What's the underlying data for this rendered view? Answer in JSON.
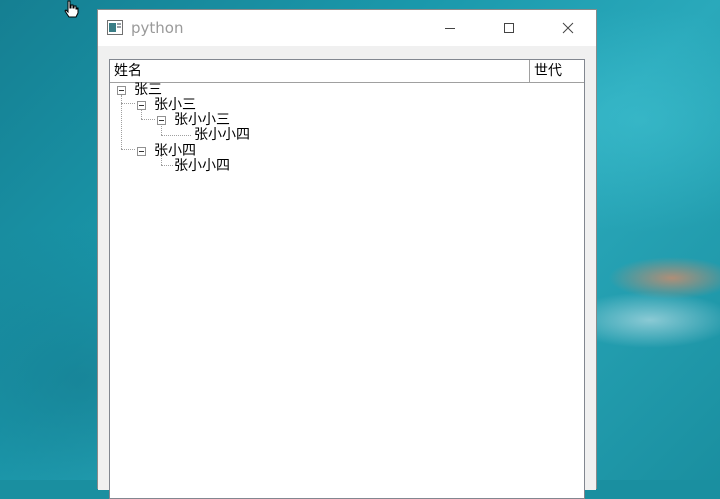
{
  "window": {
    "title": "python"
  },
  "tree": {
    "columns": [
      "姓名",
      "世代"
    ],
    "nodes": [
      {
        "label": "张三"
      },
      {
        "label": "张小三"
      },
      {
        "label": "张小小三"
      },
      {
        "label": "张小小四"
      },
      {
        "label": "张小四"
      },
      {
        "label": "张小小四"
      }
    ]
  },
  "colors": {
    "desktop_water": "#1a8fa0",
    "window_bg": "#f0f0f0",
    "title_text": "#9a9a9a",
    "tree_border": "#828790"
  }
}
